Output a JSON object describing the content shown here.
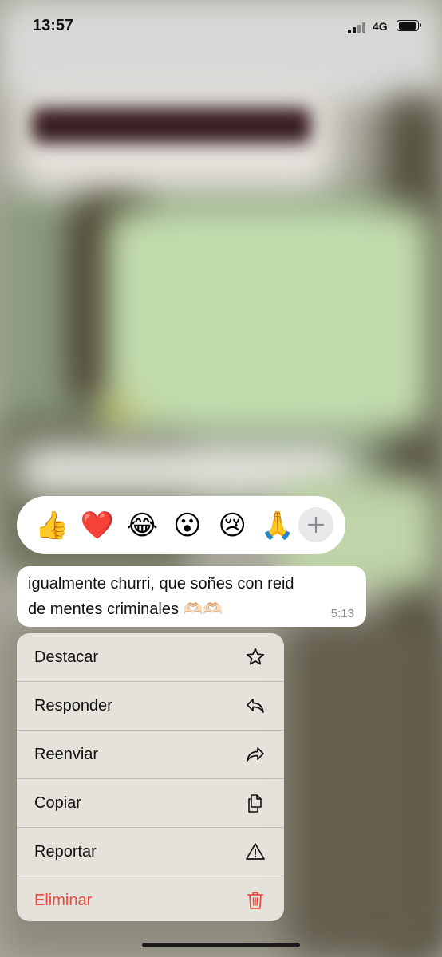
{
  "status_bar": {
    "time": "13:57",
    "network": "4G"
  },
  "reactions": {
    "emojis": [
      "👍",
      "❤️",
      "😂",
      "😮",
      "😢",
      "🙏"
    ],
    "more_label": "+"
  },
  "message": {
    "line1": "igualmente churri, que soñes con reid",
    "line2": "de mentes criminales 🫶🏻🫶🏻",
    "time": "5:13"
  },
  "menu": {
    "items": [
      {
        "label": "Destacar",
        "icon": "star-icon"
      },
      {
        "label": "Responder",
        "icon": "reply-icon"
      },
      {
        "label": "Reenviar",
        "icon": "forward-icon"
      },
      {
        "label": "Copiar",
        "icon": "copy-icon"
      },
      {
        "label": "Reportar",
        "icon": "warning-icon"
      },
      {
        "label": "Eliminar",
        "icon": "trash-icon",
        "danger": true
      }
    ]
  },
  "colors": {
    "danger": "#ea4b3e",
    "menu_bg": "#ebe8e2"
  }
}
